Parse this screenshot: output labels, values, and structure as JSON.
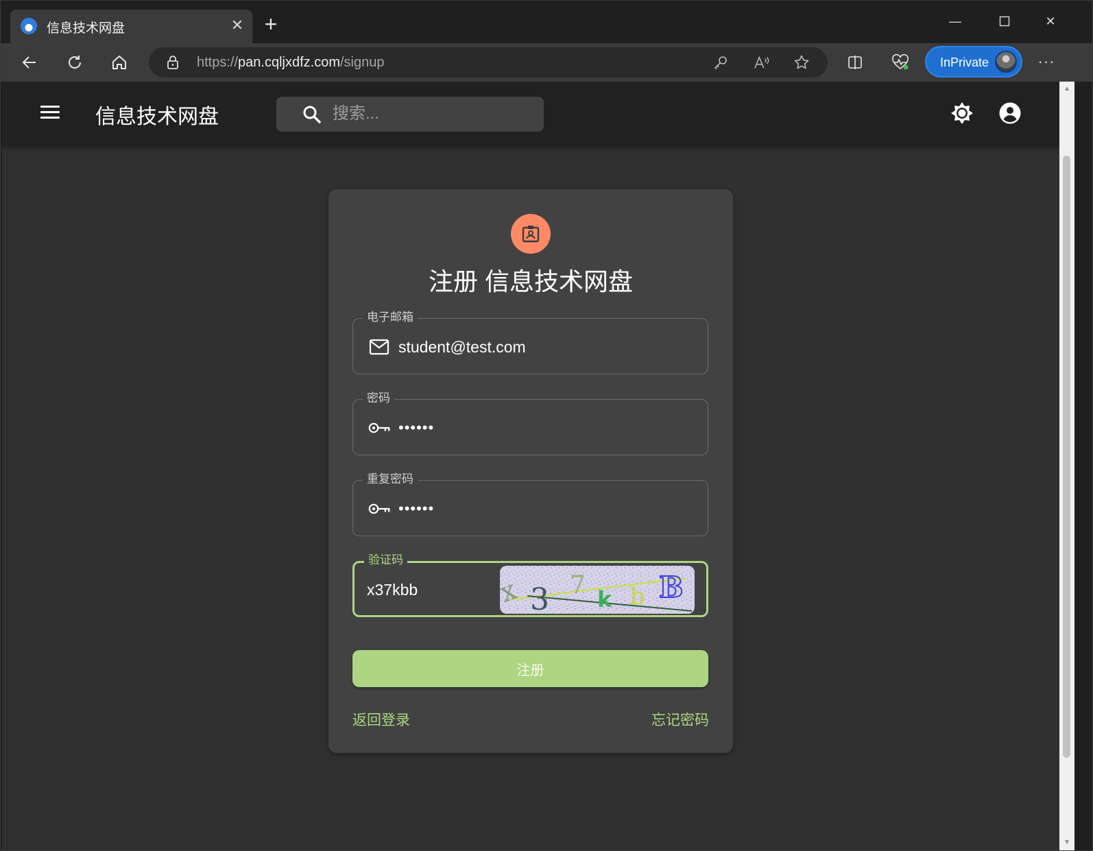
{
  "browser": {
    "tab_title": "信息技术网盘",
    "url_prefix": "https://",
    "url_host": "pan.cqljxdfz.com",
    "url_path": "/signup",
    "inprivate_label": "InPrivate"
  },
  "appbar": {
    "title": "信息技术网盘",
    "search_placeholder": "搜索..."
  },
  "signup": {
    "title": "注册 信息技术网盘",
    "email": {
      "label": "电子邮箱",
      "value": "student@test.com"
    },
    "password": {
      "label": "密码",
      "value": "••••••"
    },
    "repeat_password": {
      "label": "重复密码",
      "value": "••••••"
    },
    "captcha": {
      "label": "验证码",
      "value": "x37kbb",
      "image_text": "x37kbB"
    },
    "submit_label": "注册",
    "back_to_login": "返回登录",
    "forgot_password": "忘记密码"
  },
  "colors": {
    "accent": "#aed581",
    "avatar_bg": "#ff8a65",
    "card_bg": "#424242",
    "page_bg": "#303030",
    "appbar_bg": "#212121",
    "inprivate_bg": "#1f6fd0"
  }
}
